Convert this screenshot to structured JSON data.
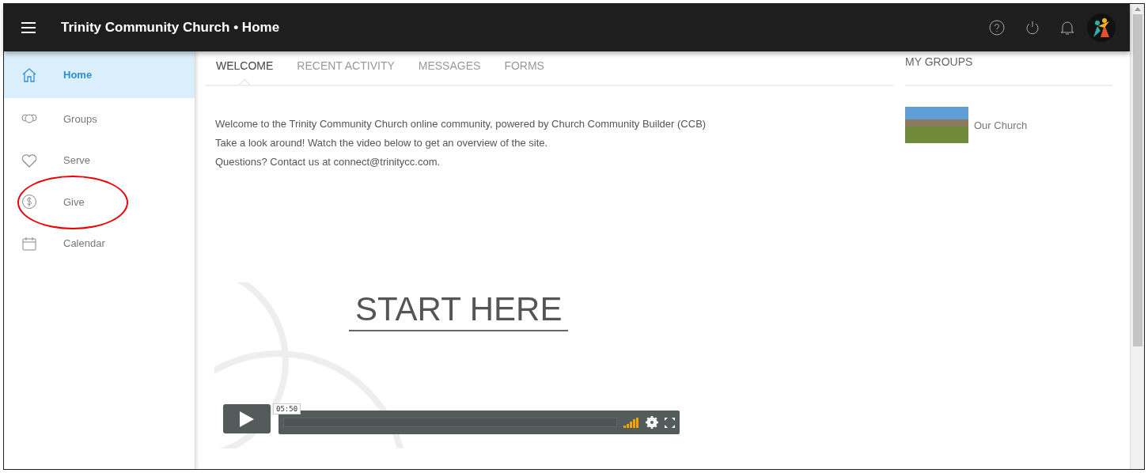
{
  "topbar": {
    "title": "Trinity Community Church • Home"
  },
  "sidebar": {
    "items": [
      {
        "label": "Home",
        "selected": true,
        "circled": false
      },
      {
        "label": "Groups",
        "selected": false,
        "circled": false
      },
      {
        "label": "Serve",
        "selected": false,
        "circled": false
      },
      {
        "label": "Give",
        "selected": false,
        "circled": true
      },
      {
        "label": "Calendar",
        "selected": false,
        "circled": false
      }
    ]
  },
  "tabs": [
    {
      "label": "WELCOME",
      "selected": true
    },
    {
      "label": "RECENT ACTIVITY",
      "selected": false
    },
    {
      "label": "MESSAGES",
      "selected": false
    },
    {
      "label": "FORMS",
      "selected": false
    }
  ],
  "welcome": {
    "lines": [
      "Welcome to the Trinity Community Church online community, powered by Church Community Builder (CCB)",
      "Take a look around! Watch the video below to get an overview of the site.",
      "Questions?  Contact us at connect@trinitycc.com."
    ]
  },
  "video": {
    "title": "START HERE",
    "time": "05:50"
  },
  "my_groups": {
    "title": "MY GROUPS",
    "groups": [
      {
        "name": "Our Church"
      }
    ]
  }
}
